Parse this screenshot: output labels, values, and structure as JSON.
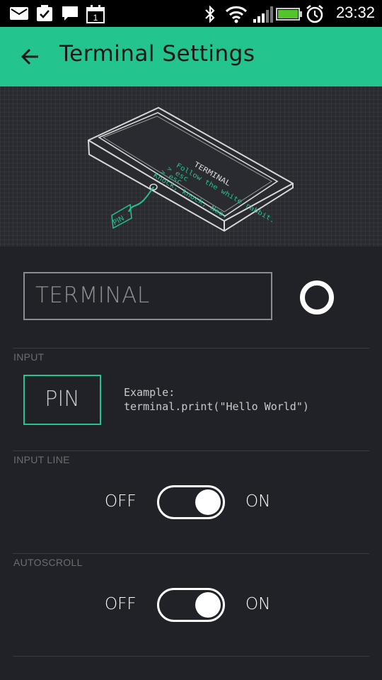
{
  "status_bar": {
    "time": "23:32",
    "icons": [
      "mail-icon",
      "clipboard-check-icon",
      "chat-icon",
      "calendar-icon",
      "bluetooth-icon",
      "wifi-icon",
      "signal-icon",
      "battery-icon",
      "alarm-icon"
    ],
    "calendar_day": "1",
    "battery_level": 1.0
  },
  "app_bar": {
    "title": "Terminal Settings",
    "color": "#23c48e"
  },
  "hero": {
    "screen_title": "TERMINAL",
    "lines": [
      "Follow the white rabbit.",
      "> esc",
      "> esc",
      "Knock, knock, Neo."
    ],
    "pin_label": "PIN"
  },
  "widget": {
    "name_value": "TERMINAL",
    "color_hex": "#ffffff"
  },
  "input": {
    "section_label": "INPUT",
    "pin_button_label": "PIN",
    "example_line1": "Example:",
    "example_line2": "terminal.print(\"Hello World\")"
  },
  "input_line": {
    "section_label": "INPUT LINE",
    "off_label": "OFF",
    "on_label": "ON",
    "value": true
  },
  "autoscroll": {
    "section_label": "AUTOSCROLL",
    "off_label": "OFF",
    "on_label": "ON",
    "value": true
  }
}
